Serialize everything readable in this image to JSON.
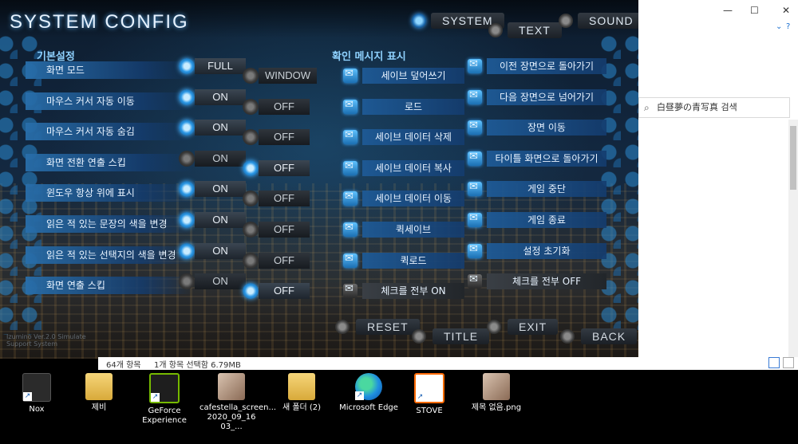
{
  "game": {
    "title": "SYSTEM CONFIG",
    "nav": {
      "system": "SYSTEM",
      "text": "TEXT",
      "sound": "SOUND"
    },
    "basic_section": "기본설정",
    "message_section": "확인 메시지 표시",
    "settings": [
      {
        "label": "화면 모드",
        "opt1": "FULL",
        "opt2": "WINDOW",
        "selected": 1
      },
      {
        "label": "마우스 커서 자동 이동",
        "opt1": "ON",
        "opt2": "OFF",
        "selected": 1
      },
      {
        "label": "마우스 커서 자동 숨김",
        "opt1": "ON",
        "opt2": "OFF",
        "selected": 1
      },
      {
        "label": "화면 전환 연출 스킵",
        "opt1": "ON",
        "opt2": "OFF",
        "selected": 2
      },
      {
        "label": "윈도우 항상 위에 표시",
        "opt1": "ON",
        "opt2": "OFF",
        "selected": 1
      },
      {
        "label": "읽은 적 있는 문장의 색을 변경",
        "opt1": "ON",
        "opt2": "OFF",
        "selected": 1
      },
      {
        "label": "읽은 적 있는 선택지의 색을 변경",
        "opt1": "ON",
        "opt2": "OFF",
        "selected": 1
      },
      {
        "label": "화면 연출 스킵",
        "opt1": "ON",
        "opt2": "OFF",
        "selected": 2
      }
    ],
    "messages_left": [
      "세이브 덮어쓰기",
      "로드",
      "세이브 데이터 삭제",
      "세이브 데이터 복사",
      "세이브 데이터 이동",
      "퀵세이브",
      "퀵로드",
      "체크를 전부 ON"
    ],
    "messages_right": [
      "이전 장면으로 돌아가기",
      "다음 장면으로 넘어가기",
      "장면 이동",
      "타이틀 화면으로 돌아가기",
      "게임 중단",
      "게임 종료",
      "설정 초기화",
      "체크를 전부 OFF"
    ],
    "buttons": {
      "reset": "RESET",
      "title": "TITLE",
      "exit": "EXIT",
      "back": "BACK"
    },
    "version": "Izumino Ver.2.0 Simulate Support System"
  },
  "explorer": {
    "search_placeholder": "白昼夢の青写真 검색",
    "status_count": "64개 항목",
    "status_selected": "1개 항목 선택함 6.79MB",
    "controls": {
      "minimize": "—",
      "maximize": "☐",
      "close": "✕"
    }
  },
  "desktop": {
    "icons": [
      {
        "name": "Nox",
        "icon": "nox-icon"
      },
      {
        "name": "제비",
        "icon": "folder-icon"
      },
      {
        "name": "GeForce Experience",
        "icon": "geforce-icon"
      },
      {
        "name": "cafestella_screen... 2020_09_16 03_...",
        "icon": "image-thumbnail-icon"
      },
      {
        "name": "새 폴더 (2)",
        "icon": "folder-icon"
      },
      {
        "name": "Microsoft Edge",
        "icon": "edge-icon"
      },
      {
        "name": "STOVE",
        "icon": "stove-icon"
      },
      {
        "name": "제목 없음.png",
        "icon": "image-thumbnail-icon"
      }
    ]
  },
  "colors": {
    "accent": "#2b98e6",
    "panel": "#1e5a96",
    "off": "#3a3a3a"
  }
}
